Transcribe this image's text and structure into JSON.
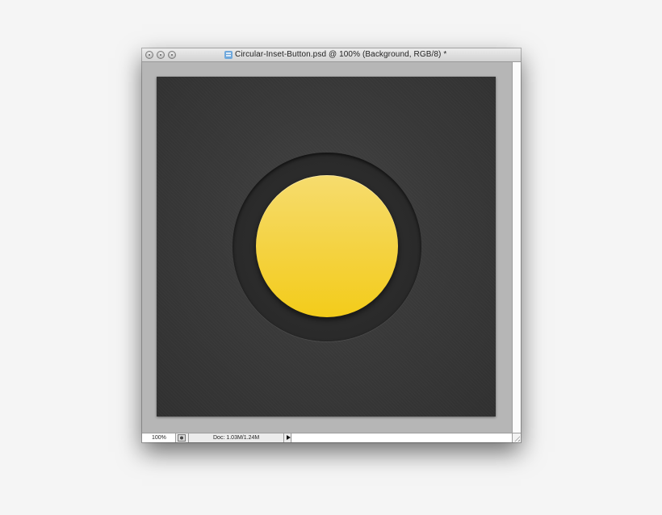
{
  "window": {
    "title": "Circular-Inset-Button.psd @ 100% (Background, RGB/8) *"
  },
  "controls": {
    "close": "close-button",
    "minimize": "minimize-button",
    "zoom": "zoom-button"
  },
  "canvas": {
    "background_color": "#3a3a3a",
    "ring_color": "#2a2a2a",
    "button_color": "#f4d030"
  },
  "statusbar": {
    "zoom": "100%",
    "doc_info": "Doc: 1.03M/1.24M"
  }
}
